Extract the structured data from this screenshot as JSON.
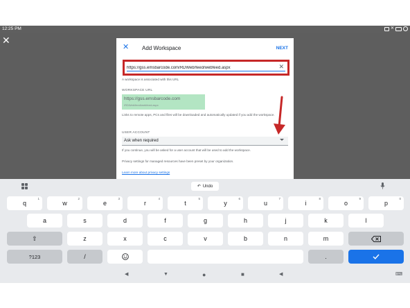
{
  "status_bar": {
    "time": "12:25 PM",
    "icons": [
      "box-icon",
      "cross-icon",
      "battery-icon",
      "circle-icon"
    ]
  },
  "dialog": {
    "title": "Add Workspace",
    "next_label": "NEXT",
    "url_value": "https://gss.emsbarcode.com/RDWeb/feed/webfeed.aspx",
    "hint": "A workspace is associated with this URL",
    "workspace_url_label": "WORKSPACE URL",
    "workspace_url_line1": "https://gss.emsbarcode.com",
    "workspace_url_line2": "/RDWeb/feed/webfeed.aspx",
    "links_text": "Links to remote apps, PCs and files will be downloaded and automatically updated if you add the workspace.",
    "user_account_label": "USER ACCOUNT",
    "user_account_value": "Ask when required",
    "continue_text": "If you continue, you will be asked for a user account that will be used to add the workspace.",
    "privacy_text": "Privacy settings for managed resources have been preset by your organization.",
    "privacy_link": "Learn more about privacy settings"
  },
  "accent_colors": {
    "primary": "#1a73e8",
    "highlight": "#c62828",
    "workspace_bg": "#b3e5c3"
  },
  "keyboard": {
    "undo_label": "Undo",
    "row1": [
      {
        "key": "q",
        "sup": "1"
      },
      {
        "key": "w",
        "sup": "2"
      },
      {
        "key": "e",
        "sup": "3"
      },
      {
        "key": "r",
        "sup": "4"
      },
      {
        "key": "t",
        "sup": "5"
      },
      {
        "key": "y",
        "sup": "6"
      },
      {
        "key": "u",
        "sup": "7"
      },
      {
        "key": "i",
        "sup": "8"
      },
      {
        "key": "o",
        "sup": "9"
      },
      {
        "key": "p",
        "sup": "0"
      }
    ],
    "row2": [
      "a",
      "s",
      "d",
      "f",
      "g",
      "h",
      "j",
      "k",
      "l"
    ],
    "row3": [
      "z",
      "x",
      "c",
      "v",
      "b",
      "n",
      "m"
    ],
    "symbols_label": "?123",
    "slash_label": "/",
    "period_label": ".",
    "icons": {
      "grid": "grid-icon",
      "mic": "mic-icon",
      "shift": "shift-icon",
      "backspace": "backspace-icon",
      "emoji": "emoji-icon",
      "enter": "check-icon"
    }
  },
  "nav": {
    "icons": [
      "volume-down-icon",
      "back-icon",
      "home-icon",
      "recents-icon",
      "volume-up-icon",
      "keyboard-switch-icon"
    ]
  }
}
